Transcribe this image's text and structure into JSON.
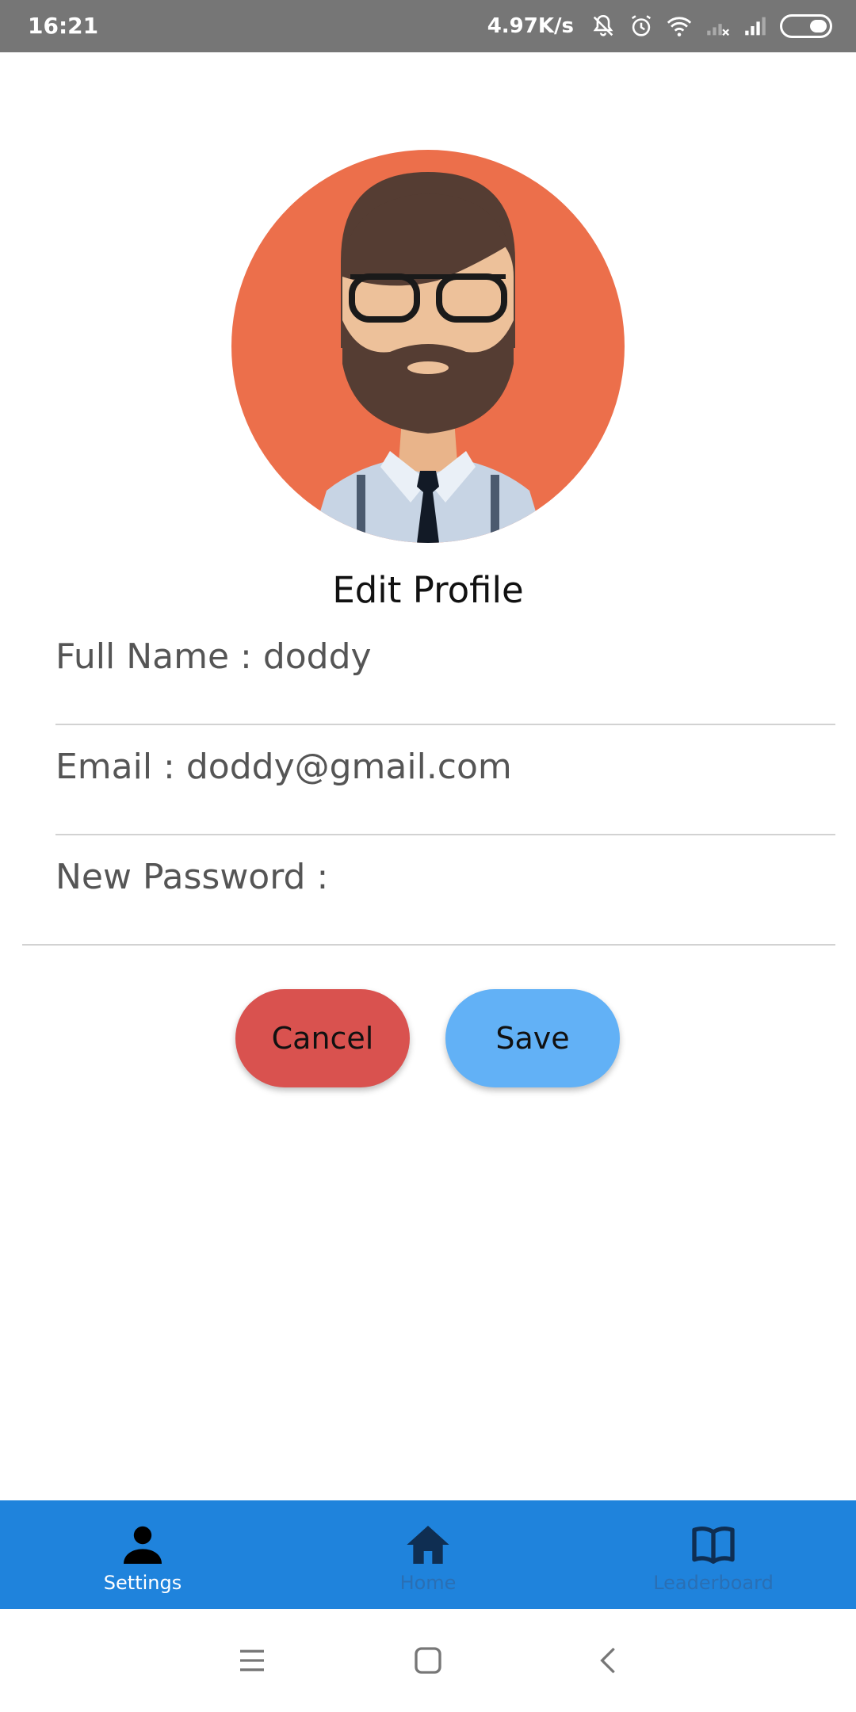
{
  "status_bar": {
    "time": "16:21",
    "net_speed": "4.97K/s",
    "icons": [
      "bell-off-icon",
      "alarm-icon",
      "wifi-icon",
      "signal-off-icon",
      "signal-icon",
      "battery-icon"
    ],
    "battery_level": 0.4
  },
  "profile": {
    "title": "Edit Profile",
    "avatar_icon": "bearded-man-avatar",
    "avatar_bg_color": "#ec6f4b"
  },
  "form": {
    "full_name": "Full Name : doddy",
    "email": "Email : doddy@gmail.com",
    "new_password": "New Password :"
  },
  "buttons": {
    "cancel": "Cancel",
    "save": "Save",
    "cancel_color": "#d9524f",
    "save_color": "#62b1f6"
  },
  "bottom_nav": {
    "color": "#1f83dc",
    "items": [
      {
        "label": "Settings",
        "icon": "person-icon",
        "active": true
      },
      {
        "label": "Home",
        "icon": "home-icon",
        "active": false
      },
      {
        "label": "Leaderboard",
        "icon": "book-icon",
        "active": false
      }
    ]
  },
  "system_nav": {
    "icons": [
      "menu-icon",
      "home-square-icon",
      "back-icon"
    ]
  }
}
